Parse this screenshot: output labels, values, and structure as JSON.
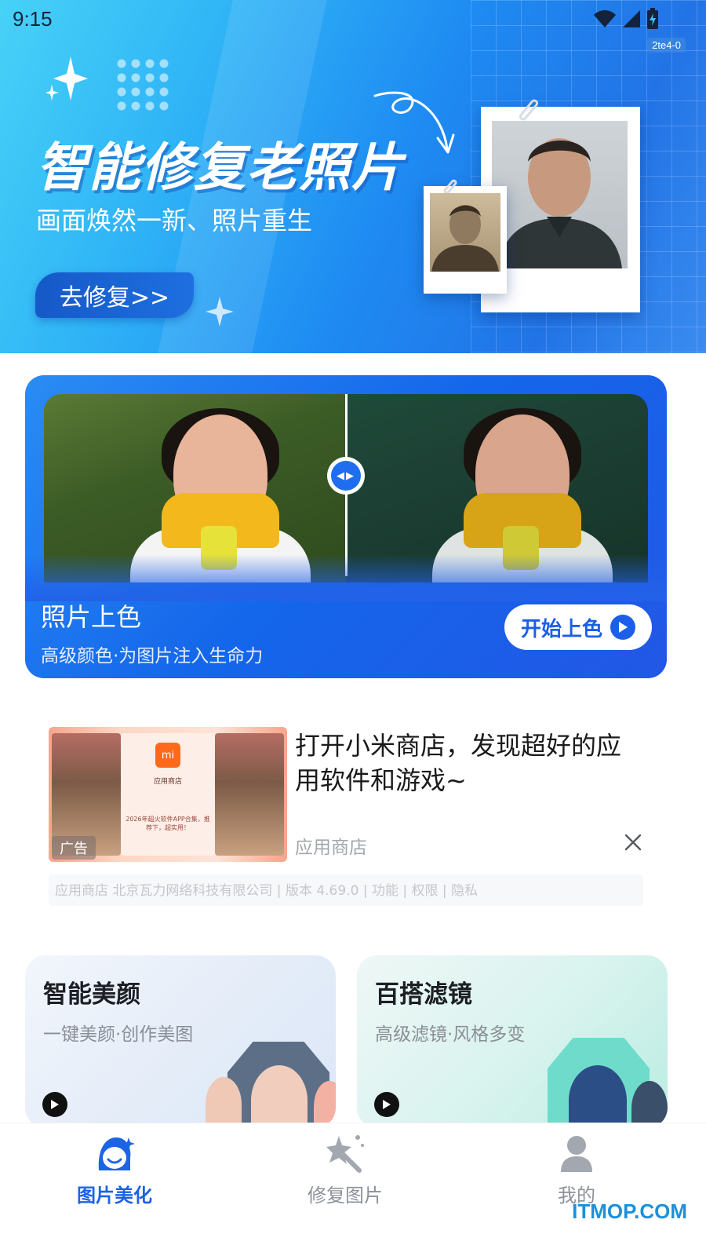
{
  "status_bar": {
    "time": "9:15",
    "build_tag": "2te4-0",
    "icons": [
      "wifi-icon",
      "signal-icon",
      "battery-charging-icon"
    ]
  },
  "hero": {
    "title": "智能修复老照片",
    "subtitle": "画面焕然一新、照片重生",
    "button_label": "去修复>>"
  },
  "colorize_card": {
    "title": "照片上色",
    "description": "高级颜色·为图片注入生命力",
    "button_label": "开始上色"
  },
  "ad": {
    "headline": "打开小米商店，发现超好的应用软件和游戏~",
    "source": "应用商店",
    "tag": "广告",
    "thumb_logo_text": "mi",
    "thumb_store_label": "应用商店",
    "thumb_caption": "2026年超火软件APP合集，推荐下，超实用！",
    "footer": "应用商店 北京瓦力网络科技有限公司 | 版本 4.69.0 | 功能 | 权限 | 隐私"
  },
  "features": [
    {
      "title": "智能美颜",
      "description": "一键美颜·创作美图"
    },
    {
      "title": "百搭滤镜",
      "description": "高级滤镜·风格多变"
    }
  ],
  "bottom_nav": {
    "items": [
      {
        "label": "图片美化",
        "icon": "beautify-face-icon",
        "active": true
      },
      {
        "label": "修复图片",
        "icon": "magic-wand-icon",
        "active": false
      },
      {
        "label": "我的",
        "icon": "user-icon",
        "active": false
      }
    ]
  },
  "watermark": "ITMOP.COM",
  "colors": {
    "accent": "#1c63e6",
    "hero_start": "#47d2f7",
    "hero_end": "#2274e6",
    "card_blue": "#1466ea",
    "muted_text": "#8c9199"
  }
}
